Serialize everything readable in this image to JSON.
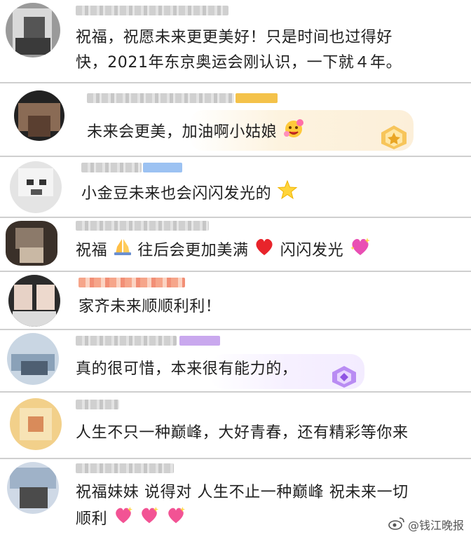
{
  "comments": [
    {
      "text_line1": "祝福，祝愿未来更更美好！只是时间也过得好",
      "text_line2": "快，2021年东京奥运会刚认识，一下就４年。"
    },
    {
      "text": "未来会更美，加油啊小姑娘"
    },
    {
      "text": "小金豆未来也会闪闪发光的"
    },
    {
      "text_a": "祝福",
      "text_b": "往后会更加美满",
      "text_c": "闪闪发光"
    },
    {
      "text": "家齐未来顺顺利利！"
    },
    {
      "text": "真的很可惜，本来很有能力的，"
    },
    {
      "text": "人生不只一种巅峰，大好青春，还有精彩等你来"
    },
    {
      "text_line1": "祝福妹妹 说得对 人生不止一种巅峰  祝未来一切",
      "text_line2": "顺利"
    }
  ],
  "watermark": {
    "label": "@钱江晚报"
  },
  "icons": [
    "star-emoji-icon",
    "pray-emoji-icon",
    "red-heart-icon",
    "sparkling-heart-icon",
    "gold-badge-icon",
    "purple-badge-icon",
    "heart-face-emoji-icon",
    "weibo-logo-icon"
  ],
  "colors": {
    "separator": "#cfcfcf",
    "text": "#1f1f1f",
    "gold_bubble": "#fdf3df",
    "purple_bubble": "#f6f0ff"
  }
}
